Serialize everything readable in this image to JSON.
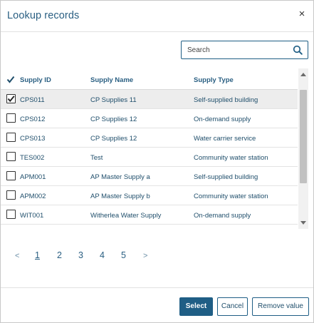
{
  "dialog": {
    "title": "Lookup records",
    "close_glyph": "×"
  },
  "search": {
    "placeholder": "Search",
    "icon": "search-icon"
  },
  "table": {
    "columns": [
      "Supply ID",
      "Supply Name",
      "Supply Type"
    ],
    "rows": [
      {
        "id": "CPS011",
        "name": "CP Supplies 11",
        "type": "Self-supplied building",
        "checked": true
      },
      {
        "id": "CPS012",
        "name": "CP Supplies 12",
        "type": "On-demand supply",
        "checked": false
      },
      {
        "id": "CPS013",
        "name": "CP Supplies 12",
        "type": "Water carrier service",
        "checked": false
      },
      {
        "id": "TES002",
        "name": "Test",
        "type": "Community water station",
        "checked": false
      },
      {
        "id": "APM001",
        "name": "AP Master Supply a",
        "type": "Self-supplied building",
        "checked": false
      },
      {
        "id": "APM002",
        "name": "AP Master Supply b",
        "type": "Community water station",
        "checked": false
      },
      {
        "id": "WIT001",
        "name": "Witherlea Water Supply",
        "type": "On-demand supply",
        "checked": false
      }
    ]
  },
  "pager": {
    "prev": "<",
    "next": ">",
    "pages": [
      "1",
      "2",
      "3",
      "4",
      "5"
    ],
    "current": "1"
  },
  "footer": {
    "select_label": "Select",
    "cancel_label": "Cancel",
    "remove_label": "Remove value"
  },
  "colors": {
    "primary": "#1f5e85",
    "text": "#1f4e6b",
    "selected_row": "#ededed"
  }
}
